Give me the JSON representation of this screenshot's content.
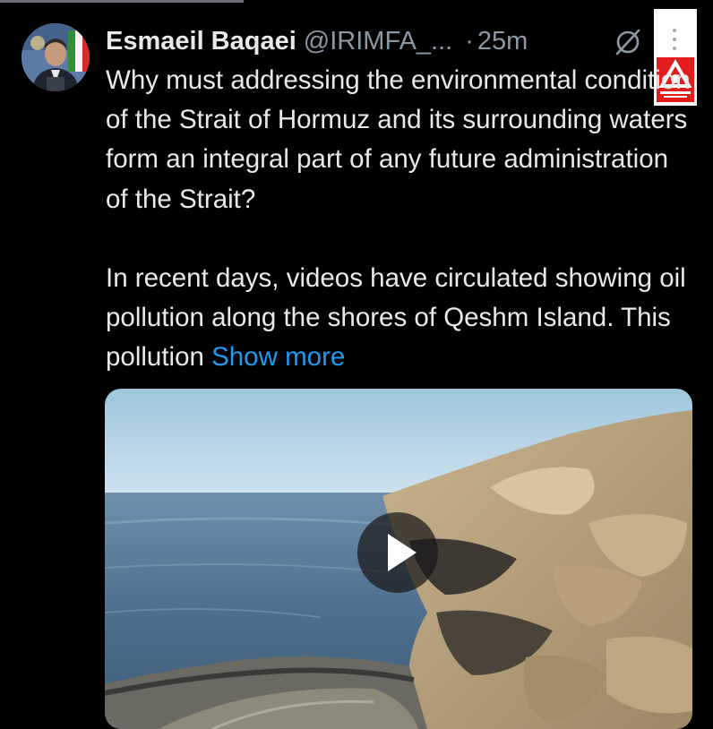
{
  "author": {
    "name": "Esmaeil Baqaei",
    "handle": "@IRIMFA_...",
    "separator": "·",
    "time": "25m"
  },
  "tweet": {
    "paragraph1": "Why must addressing the environmental condition of the Strait of Hormuz and its surrounding waters form an integral part of any future administration of the Strait?",
    "paragraph2": "In recent days, videos have circulated showing oil pollution along the shores of Qeshm Island. This pollution",
    "show_more": "Show more"
  },
  "icons": {
    "grok": "grok-icon",
    "more": "more-icon",
    "play": "play-icon",
    "watermark": "channel-logo"
  },
  "colors": {
    "background": "#000000",
    "text": "#e7e9ea",
    "muted": "#8b98a5",
    "link": "#1d9bf0",
    "watermark_red": "#e31b1b"
  }
}
